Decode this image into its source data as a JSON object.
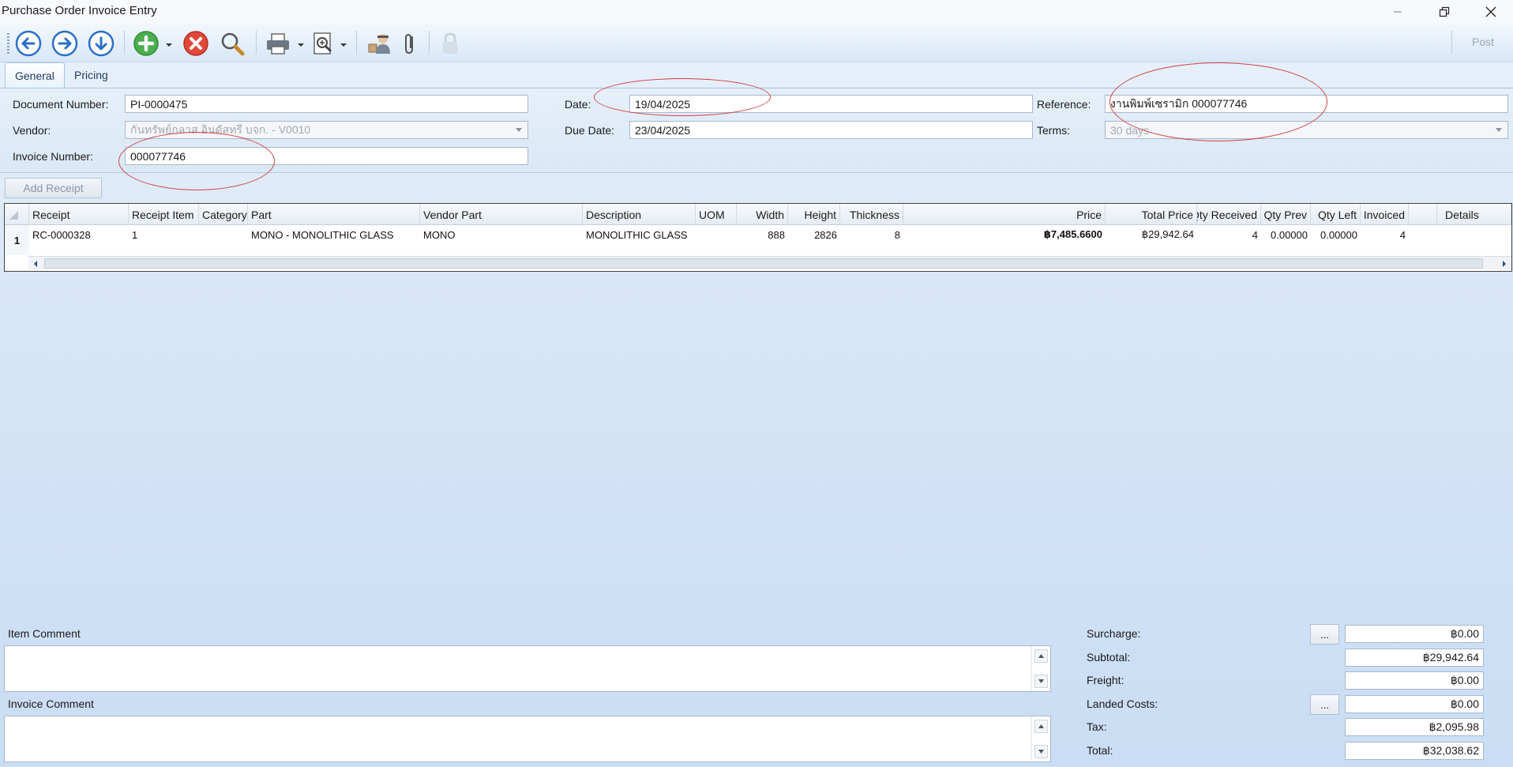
{
  "window": {
    "title": "Purchase Order Invoice Entry"
  },
  "toolbar": {
    "icons": [
      "arrow-left-icon",
      "arrow-right-icon",
      "arrow-down-icon",
      "add-icon",
      "delete-icon",
      "search-icon",
      "print-icon",
      "preview-icon",
      "user-icon",
      "attach-icon",
      "lock-icon"
    ],
    "post_label": "Post"
  },
  "tabs": [
    {
      "label": "General"
    },
    {
      "label": "Pricing"
    }
  ],
  "form": {
    "document_number_label": "Document Number:",
    "document_number": "PI-0000475",
    "vendor_label": "Vendor:",
    "vendor": "กันทรัพย์กลาส อินดัสทรี บจก. - V0010",
    "invoice_number_label": "Invoice Number:",
    "invoice_number": "000077746",
    "date_label": "Date:",
    "date": "19/04/2025",
    "due_date_label": "Due Date:",
    "due_date": "23/04/2025",
    "reference_label": "Reference:",
    "reference": "งานพิมพ์เซรามิก 000077746",
    "terms_label": "Terms:",
    "terms": "30 days",
    "add_receipt_label": "Add Receipt"
  },
  "grid": {
    "columns": [
      "Receipt",
      "Receipt Item",
      "Category",
      "Part",
      "Vendor Part",
      "Description",
      "UOM",
      "Width",
      "Height",
      "Thickness",
      "Price",
      "Total Price",
      "Qty Received",
      "Qty Prev",
      "Qty Left",
      "Invoiced",
      "Details"
    ],
    "rows": [
      {
        "row_num": "1",
        "receipt": "RC-0000328",
        "receipt_item": "1",
        "category": "",
        "part": "MONO - MONOLITHIC GLASS",
        "vendor_part": "MONO",
        "description": "MONOLITHIC GLASS",
        "uom": "",
        "width": "888",
        "height": "2826",
        "thickness": "8",
        "price": "฿7,485.6600",
        "total_price": "฿29,942.64",
        "qty_received": "4",
        "qty_prev": "0.00000",
        "qty_left": "0.00000",
        "invoiced": "4",
        "details": ""
      }
    ]
  },
  "comments": {
    "item_comment_label": "Item Comment",
    "item_comment": "",
    "invoice_comment_label": "Invoice Comment",
    "invoice_comment": ""
  },
  "totals": {
    "surcharge_label": "Surcharge:",
    "surcharge": "฿0.00",
    "subtotal_label": "Subtotal:",
    "subtotal": "฿29,942.64",
    "freight_label": "Freight:",
    "freight": "฿0.00",
    "landed_costs_label": "Landed Costs:",
    "landed_costs": "฿0.00",
    "tax_label": "Tax:",
    "tax": "฿2,095.98",
    "total_label": "Total:",
    "total": "฿32,038.62",
    "ellipsis_label": "..."
  },
  "colors": {
    "annotation_oval": "#d04040",
    "toolbar_blue": "#2a6fc9",
    "delete_red": "#e0483a",
    "add_green": "#4bae4f"
  }
}
